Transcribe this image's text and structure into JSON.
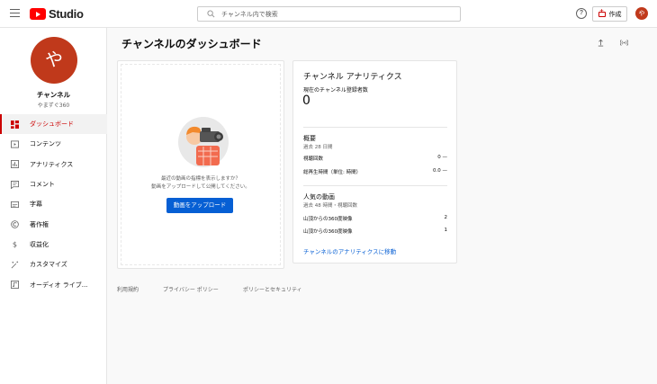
{
  "header": {
    "logo_text": "Studio",
    "search_placeholder": "チャンネル内で検索",
    "help_label": "?",
    "create_label": "作成",
    "avatar_initial": "や"
  },
  "sidebar": {
    "channel_initial": "や",
    "channel_name": "チャンネル",
    "channel_handle": "やまずぐ360",
    "items": [
      {
        "label": "ダッシュボード",
        "icon": "dashboard-icon",
        "active": true
      },
      {
        "label": "コンテンツ",
        "icon": "content-icon"
      },
      {
        "label": "アナリティクス",
        "icon": "analytics-icon"
      },
      {
        "label": "コメント",
        "icon": "comment-icon"
      },
      {
        "label": "字幕",
        "icon": "subtitles-icon"
      },
      {
        "label": "著作権",
        "icon": "copyright-icon"
      },
      {
        "label": "収益化",
        "icon": "dollar-icon"
      },
      {
        "label": "カスタマイズ",
        "icon": "magic-wand-icon"
      },
      {
        "label": "オーディオ ライブ...",
        "icon": "audio-library-icon"
      }
    ]
  },
  "main": {
    "title": "チャンネルのダッシュボード",
    "upload_card": {
      "message_line1": "最近の動画の指標を表示しますか？",
      "message_line2": "動画をアップロードして公開してください。",
      "button_label": "動画をアップロード"
    },
    "analytics_card": {
      "title": "チャンネル アナリティクス",
      "subscribers_label": "現在のチャンネル登録者数",
      "subscribers_count": "0",
      "summary_title": "概要",
      "summary_period": "過去 28 日間",
      "summary_rows": [
        {
          "label": "視聴回数",
          "value": "0 —"
        },
        {
          "label": "総再生時間（単位: 時間）",
          "value": "0.0 —"
        }
      ],
      "top_videos_title": "人気の動画",
      "top_videos_period": "過去 48 時間・視聴回数",
      "top_videos": [
        {
          "label": "山頂からの360度映像",
          "value": "2"
        },
        {
          "label": "山頂からの360度映像",
          "value": "1"
        }
      ],
      "link_label": "チャンネルのアナリティクスに移動"
    }
  },
  "footer": {
    "links": [
      "利用規約",
      "プライバシー ポリシー",
      "ポリシーとセキュリティ"
    ]
  },
  "colors": {
    "accent_red": "#cc0000",
    "avatar_bg": "#c0391b",
    "primary_blue": "#065fd4"
  }
}
